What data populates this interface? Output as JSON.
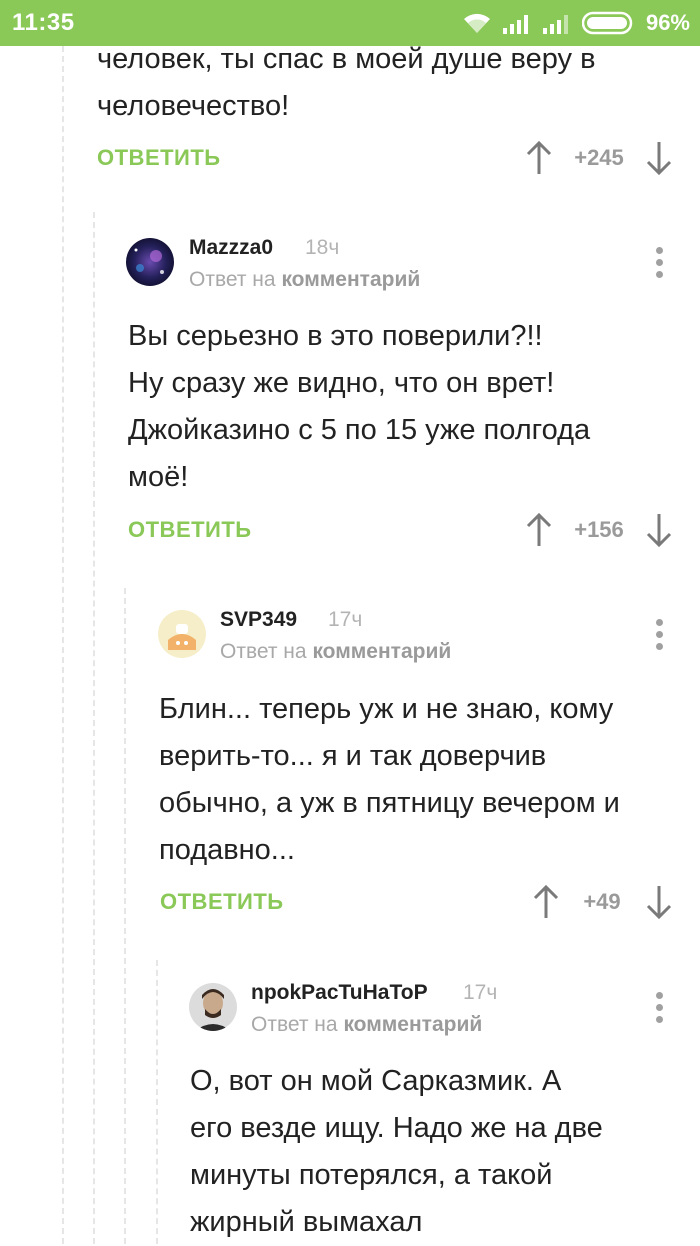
{
  "status_bar": {
    "time": "11:35",
    "battery": "96%"
  },
  "colors": {
    "accent": "#8ac858",
    "text": "#222222",
    "muted": "#a8a8a8"
  },
  "top_comment": {
    "lines": [
      "человек, ты спас в моей душе веру в",
      "человечество!"
    ],
    "reply_label": "ОТВЕТИТЬ",
    "score": "+245"
  },
  "comments": [
    {
      "author": "Mazzza0",
      "time": "18ч",
      "subtitle_prefix": "Ответ на",
      "subtitle_link": "комментарий",
      "lines": [
        "Вы серьезно в это поверили?!!",
        "Ну сразу же видно, что он врет!",
        "Джойказино с 5 по 15 уже полгода",
        "моё!"
      ],
      "reply_label": "ОТВЕТИТЬ",
      "score": "+156"
    },
    {
      "author": "SVP349",
      "time": "17ч",
      "subtitle_prefix": "Ответ на",
      "subtitle_link": "комментарий",
      "lines": [
        "Блин... теперь уж и не знаю, кому",
        "верить-то... я и так доверчив",
        "обычно, а уж в пятницу вечером и",
        "подавно..."
      ],
      "reply_label": "ОТВЕТИТЬ",
      "score": "+49"
    },
    {
      "author": "npokPacTuHaToP",
      "time": "17ч",
      "subtitle_prefix": "Ответ на",
      "subtitle_link": "комментарий",
      "lines": [
        "О, вот он мой Сарказмик. А",
        "его везде ищу. Надо же на две",
        "минуты потерялся, а такой",
        "жирный вымахал"
      ]
    }
  ]
}
